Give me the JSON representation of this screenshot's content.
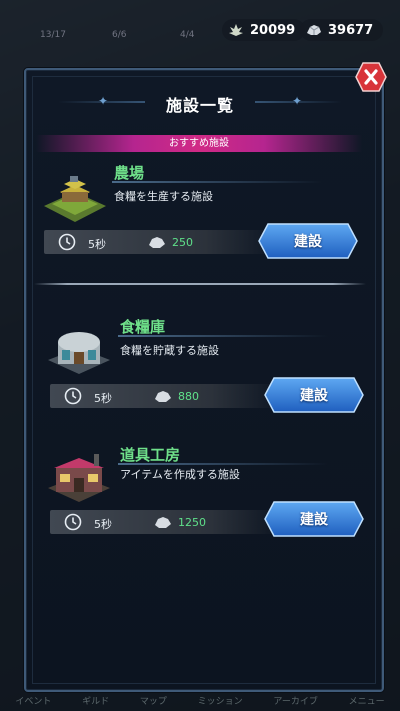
{
  "resources": {
    "herb_count": "20099",
    "stone_count": "39677",
    "herb_icon": "herb-icon",
    "stone_icon": "stone-icon"
  },
  "background": {
    "stat_a": "13/17",
    "stat_b": "6/6",
    "stat_c": "4/4"
  },
  "panel": {
    "title": "施設一覧",
    "section_label": "おすすめ施設"
  },
  "facilities": [
    {
      "name": "農場",
      "description": "食糧を生産する施設",
      "time": "5秒",
      "cost": "250",
      "build_label": "建設"
    },
    {
      "name": "食糧庫",
      "description": "食糧を貯蔵する施設",
      "time": "5秒",
      "cost": "880",
      "build_label": "建設"
    },
    {
      "name": "道具工房",
      "description": "アイテムを作成する施設",
      "time": "5秒",
      "cost": "1250",
      "build_label": "建設"
    }
  ],
  "bottom_tabs": [
    "イベント",
    "ギルド",
    "マップ",
    "ミッション",
    "アーカイブ",
    "メニュー"
  ],
  "colors": {
    "accent_green": "#6fe08a",
    "banner_pink": "#d12a86",
    "button_blue": "#2f7fe0",
    "close_red": "#d8343a"
  }
}
